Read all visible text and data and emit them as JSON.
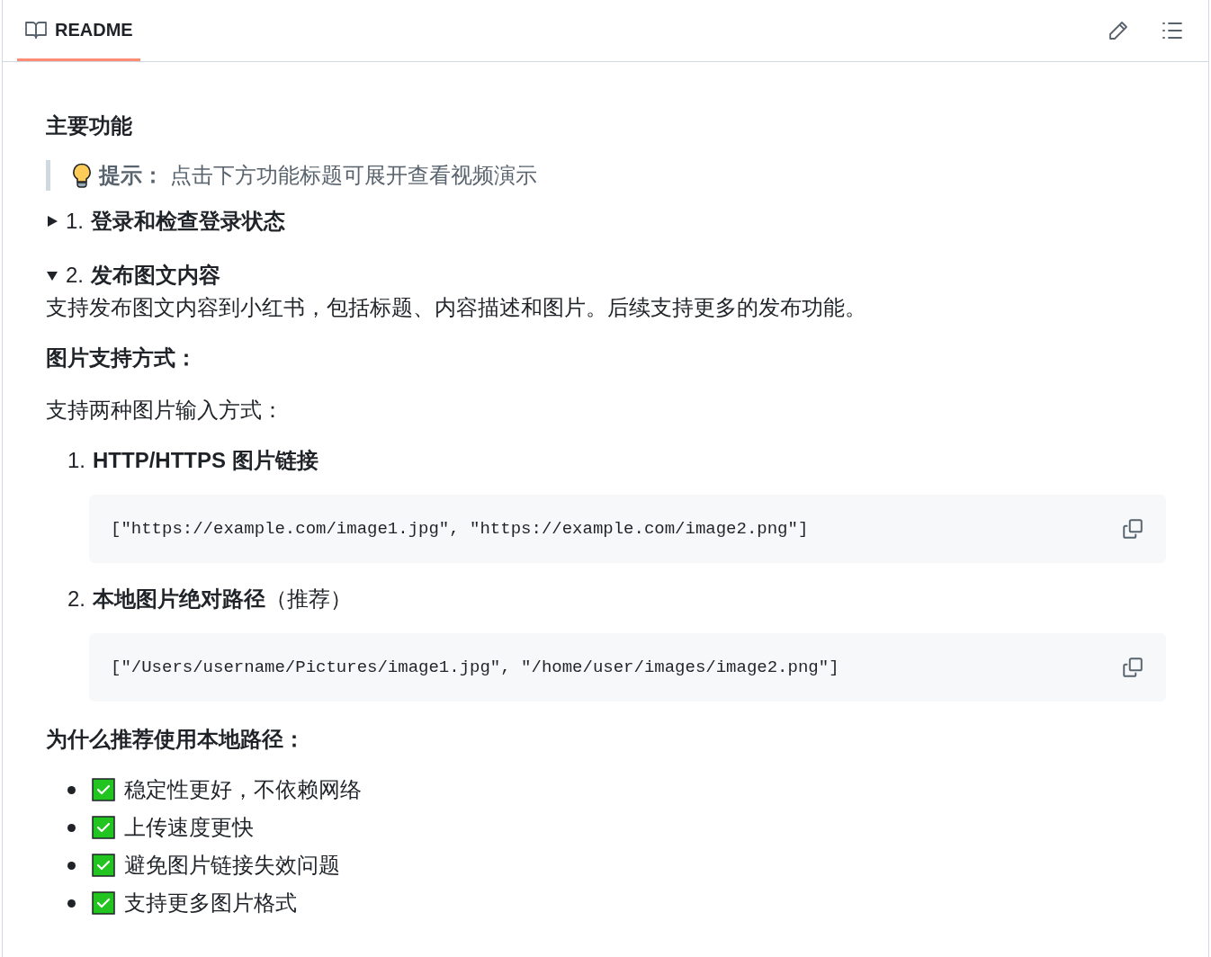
{
  "header": {
    "tabs": [
      {
        "label": "README",
        "selected": true
      }
    ]
  },
  "heading": "主要功能",
  "tip": {
    "label": "提示：",
    "text": "点击下方功能标题可展开查看视频演示"
  },
  "sections": [
    {
      "marker": "1.",
      "title": "登录和检查登录状态",
      "expanded": false
    },
    {
      "marker": "2.",
      "title": "发布图文内容",
      "expanded": true
    }
  ],
  "description": "支持发布图文内容到小红书，包括标题、内容描述和图片。后续支持更多的发布功能。",
  "image_heading": "图片支持方式：",
  "image_intro": "支持两种图片输入方式：",
  "methods": [
    {
      "number": "1.",
      "text": "**HTTP/HTTPS 图片链接**",
      "code": "[\"https://example.com/image1.jpg\", \"https://example.com/image2.png\"]"
    },
    {
      "number": "2.",
      "text": "**本地图片绝对路径**（推荐）",
      "code": "[\"/Users/username/Pictures/image1.jpg\", \"/home/user/images/image2.png\"]"
    }
  ],
  "why_heading": "为什么推荐使用本地路径：",
  "reasons": [
    {
      "text": "稳定性更好，不依赖网络",
      "checked": true
    },
    {
      "text": "上传速度更快",
      "checked": true
    },
    {
      "text": "避免图片链接失效问题",
      "checked": true
    },
    {
      "text": "支持更多图片格式",
      "checked": true
    }
  ]
}
